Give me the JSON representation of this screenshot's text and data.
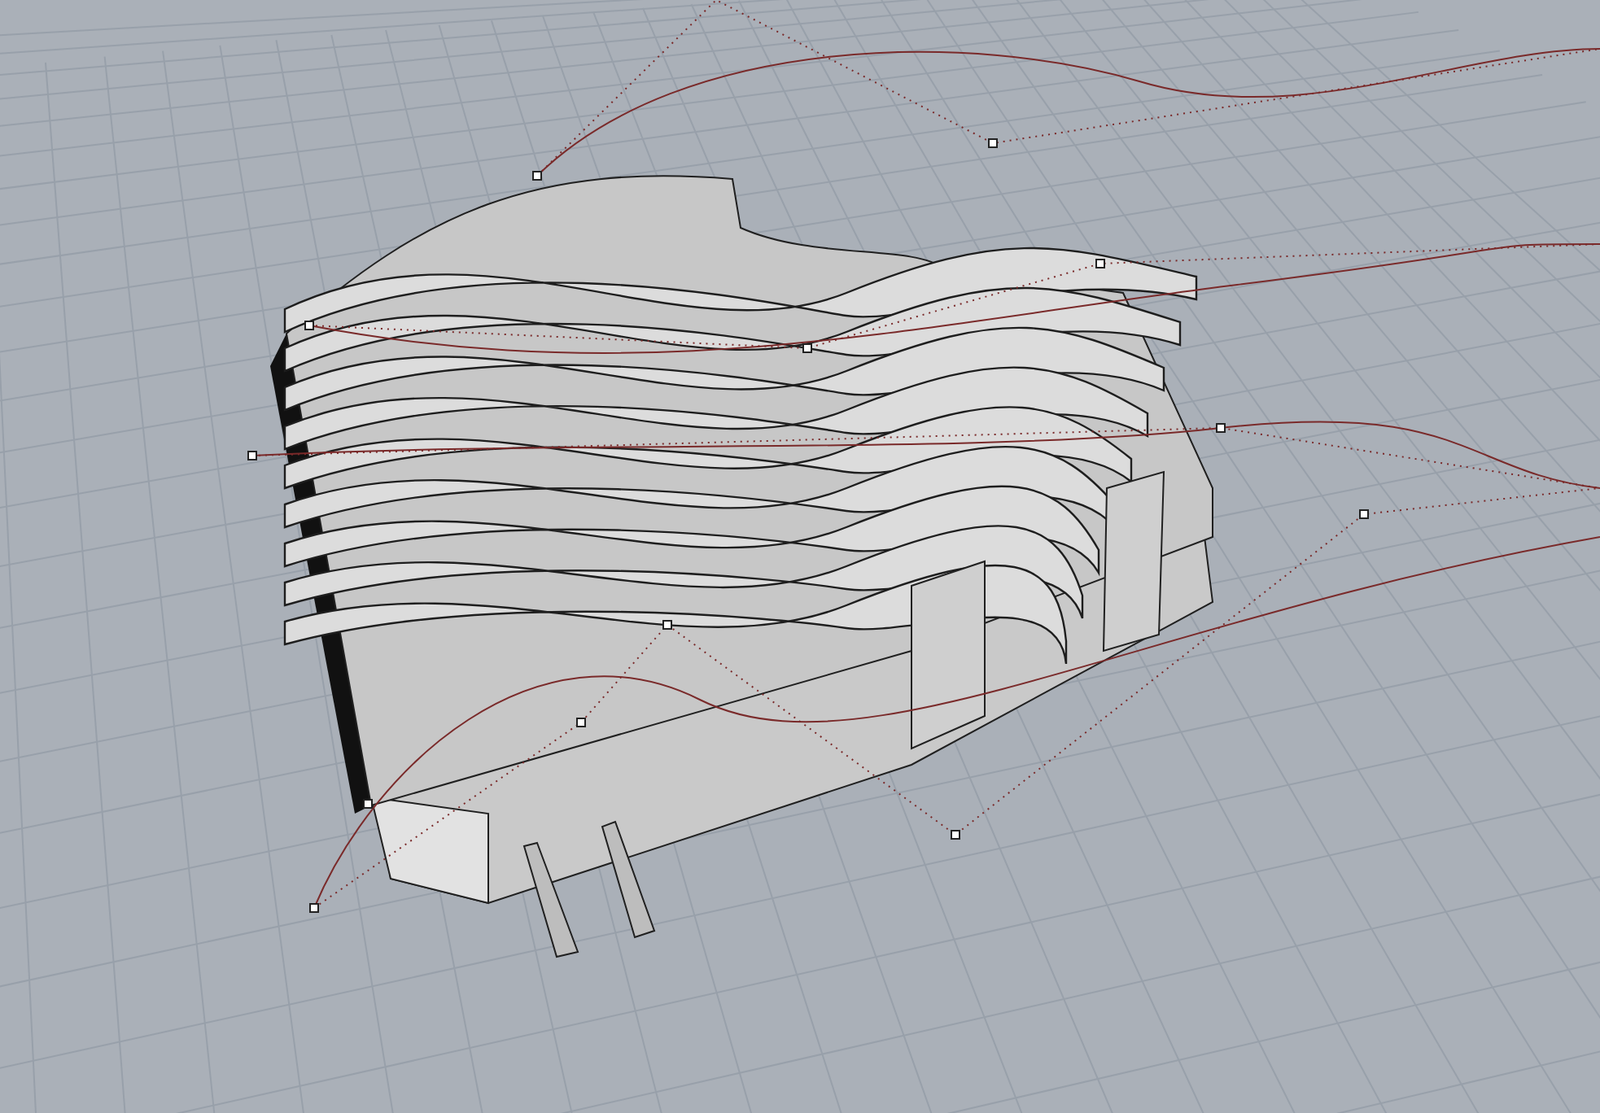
{
  "viewport": {
    "grid": true,
    "control_points": true
  }
}
